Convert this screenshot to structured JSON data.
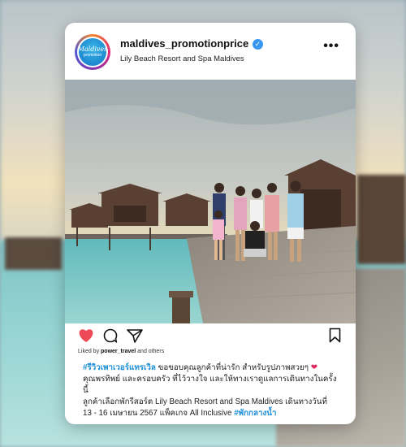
{
  "post": {
    "username": "maldives_promotionprice",
    "location": "Lily Beach Resort and Spa Maldives",
    "avatar_text_line1": "Maldives",
    "avatar_text_line2": "promotion",
    "liked_by_prefix": "Liked by ",
    "liked_by_user": "power_travel",
    "liked_by_suffix": " and others",
    "caption_hashtag_start": "#รีวิวเพาเวอร์แทรเวิล",
    "caption_line1": " ขอขอบคุณลูกค้าที่น่ารัก สำหรับรูปภาพสวยๆ ",
    "caption_heart": "❤",
    "caption_line2": "คุณพรทิพย์ และครอบครัว ที่ไว้วางใจ และให้ทางเราดูแลการเดินทางในครั้งนี้",
    "caption_line3": "ลูกค้าเลือกพักรีสอร์ต Lily Beach Resort and Spa Maldives เดินทางวันที่",
    "caption_line4": "13 - 16 เมษายน 2567 แพ็คเกจ All Inclusive ",
    "caption_hashtag_end": "#พักกลางน้ำ"
  },
  "icons": {
    "more": "more-options-icon",
    "verified": "verified-badge-icon",
    "like": "heart-icon",
    "comment": "comment-icon",
    "share": "share-icon",
    "save": "bookmark-icon"
  },
  "colors": {
    "accent_blue": "#3897f0",
    "hashtag": "#1f8fd6",
    "like_red": "#ed4956"
  }
}
